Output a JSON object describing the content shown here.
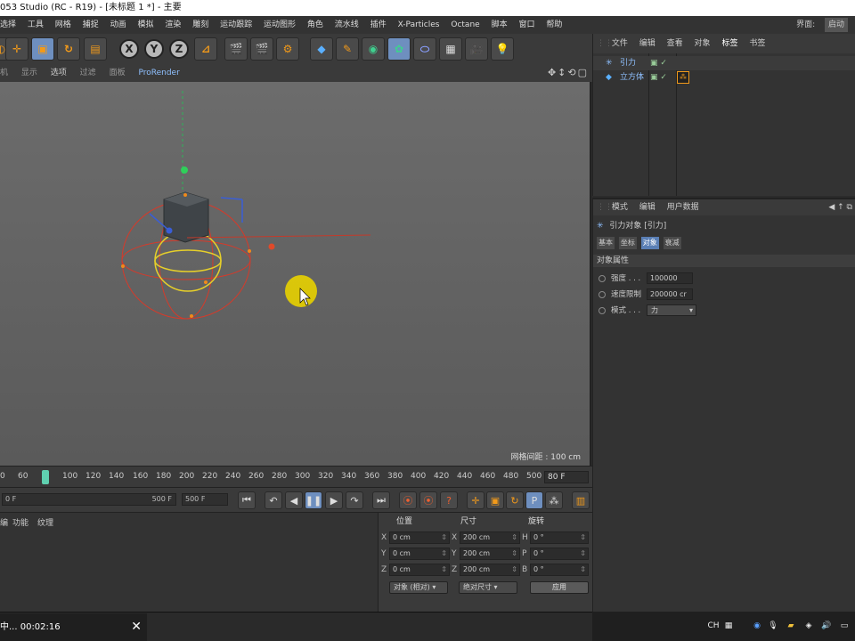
{
  "window": {
    "title": "053 Studio (RC - R19) - [未标题 1 *] - 主要"
  },
  "menu": {
    "items": [
      "选择",
      "工具",
      "网格",
      "捕捉",
      "动画",
      "模拟",
      "渲染",
      "雕刻",
      "运动跟踪",
      "运动图形",
      "角色",
      "流水线",
      "插件",
      "X-Particles",
      "Octane",
      "脚本",
      "窗口",
      "帮助"
    ],
    "right_label": "界面:",
    "right_button": "启动"
  },
  "toolbar": {
    "axis_x": "X",
    "axis_y": "Y",
    "axis_z": "Z"
  },
  "viewport_menu": {
    "items": [
      "机",
      "显示",
      "选项",
      "过滤",
      "面板",
      "ProRender"
    ]
  },
  "viewport": {
    "grid_label": "网格间距 : 100 cm"
  },
  "timeline": {
    "ticks": [
      "0",
      "60",
      "80",
      "100",
      "120",
      "140",
      "160",
      "180",
      "200",
      "220",
      "240",
      "260",
      "280",
      "300",
      "320",
      "340",
      "360",
      "380",
      "400",
      "420",
      "440",
      "460",
      "480",
      "500"
    ],
    "current_frame": "80 F"
  },
  "playback": {
    "start": "0 F",
    "end_inner": "500 F",
    "end": "500 F"
  },
  "material_panel": {
    "tabs": [
      "编",
      "功能",
      "纹理"
    ]
  },
  "coord_panel": {
    "header_pos": "位置",
    "header_size": "尺寸",
    "header_rot": "旋转",
    "rows": [
      {
        "pl": "X",
        "pv": "0 cm",
        "sl": "X",
        "sv": "200 cm",
        "rl": "H",
        "rv": "0 °"
      },
      {
        "pl": "Y",
        "pv": "0 cm",
        "sl": "Y",
        "sv": "200 cm",
        "rl": "P",
        "rv": "0 °"
      },
      {
        "pl": "Z",
        "pv": "0 cm",
        "sl": "Z",
        "sv": "200 cm",
        "rl": "B",
        "rv": "0 °"
      }
    ],
    "mode_dropdown": "对象 (相对)",
    "size_dropdown": "绝对尺寸",
    "apply_button": "应用"
  },
  "object_panel": {
    "menu": [
      "文件",
      "编辑",
      "查看",
      "对象",
      "标签",
      "书签"
    ],
    "objects": [
      {
        "name": "引力"
      },
      {
        "name": "立方体"
      }
    ]
  },
  "attr_panel": {
    "menu": [
      "模式",
      "编辑",
      "用户数据"
    ],
    "title": "引力对象 [引力]",
    "tabs": [
      "基本",
      "坐标",
      "对象",
      "衰减"
    ],
    "section": "对象属性",
    "rows": [
      {
        "label": "强度 . . .",
        "value": "100000"
      },
      {
        "label": "速度限制",
        "value": "200000 cr"
      },
      {
        "label": "模式 . . .",
        "value": "力"
      }
    ]
  },
  "taskbar": {
    "recording": "中... 00:02:16",
    "lang": "CH"
  },
  "colors": {
    "accent": "#6e8fbf",
    "selection_ring": "#e6cf2a",
    "object_name": "#8fc0ff"
  }
}
